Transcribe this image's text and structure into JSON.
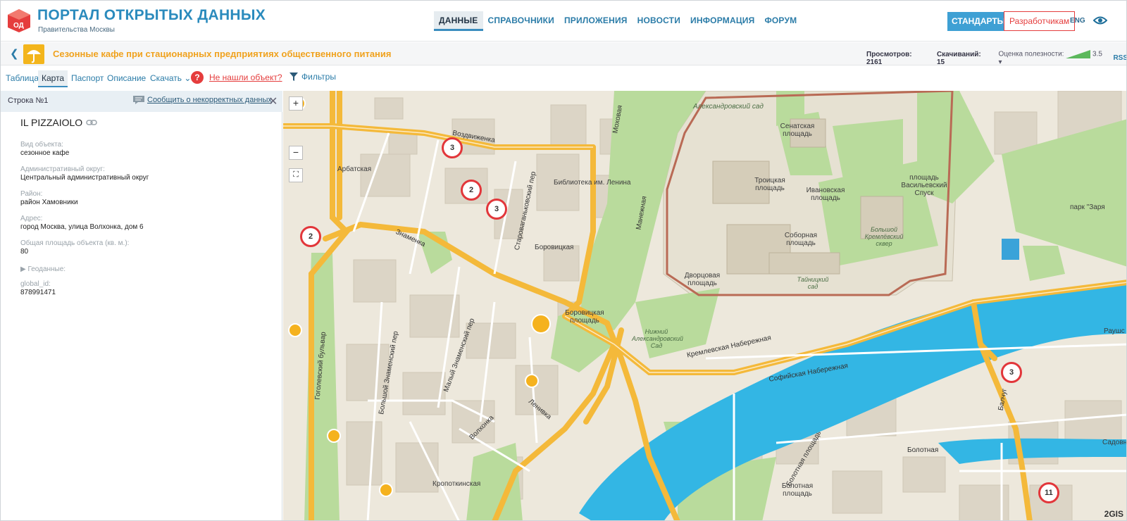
{
  "header": {
    "title": "ПОРТАЛ ОТКРЫТЫХ ДАННЫХ",
    "subtitle": "Правительства Москвы",
    "logo_text": "ОД",
    "nav": [
      "ДАННЫЕ",
      "СПРАВОЧНИКИ",
      "ПРИЛОЖЕНИЯ",
      "НОВОСТИ",
      "ИНФОРМАЦИЯ",
      "ФОРУМ"
    ],
    "standards": "СТАНДАРТЫ",
    "developers": "Разработчикам",
    "lang": "ENG"
  },
  "titlebar": {
    "title": "Сезонные кафе при стационарных предприятиях общественного питания",
    "views_label": "Просмотров:",
    "views": "2161",
    "downloads_label": "Скачиваний:",
    "downloads": "15",
    "rating_label": "Оценка полезности:",
    "rating": "3.5",
    "rss": "RSS"
  },
  "tabs": {
    "table": "Таблица",
    "map": "Карта",
    "passport": "Паспорт",
    "description": "Описание",
    "download": "Скачать",
    "not_found": "Не нашли объект?",
    "filters": "Фильтры"
  },
  "panel": {
    "row": "Строка №1",
    "report": "Сообщить о некорректных данных",
    "object_name": "IL PIZZAIOLO",
    "fields": [
      {
        "label": "Вид объекта:",
        "value": "сезонное кафе"
      },
      {
        "label": "Административный округ:",
        "value": "Центральный административный округ"
      },
      {
        "label": "Район:",
        "value": "район Хамовники"
      },
      {
        "label": "Адрес:",
        "value": "город Москва, улица Волхонка, дом 6"
      },
      {
        "label": "Общая площадь объекта (кв. м.):",
        "value": "80"
      }
    ],
    "geodata": "▶ Геоданные:",
    "global_id_label": "global_id:",
    "global_id": "878991471"
  },
  "map": {
    "labels": {
      "alex_garden_top": "Александровский сад",
      "senate_sq": "Сенатская площадь",
      "troitskaya_sq": "Троицкая площадь",
      "ivanovskaya_sq": "Ивановская площадь",
      "vasilievsky": "площадь Васильевский Спуск",
      "sobornaya": "Соборная площадь",
      "great_kremlin": "Большой Кремлёвский сквер",
      "dvortsovaya": "Дворцовая площадь",
      "tainitsky": "Тайницкий сад",
      "alex_garden_bottom": "Нижний Александровский Сад",
      "kremlin_emb": "Кремлевская Набережная",
      "sofia_emb": "Софийская Набережная",
      "arbatskaya": "Арбатская",
      "vozdvizhenka": "Воздвиженка",
      "library": "Библиотека им. Ленина",
      "borovitskaya": "Боровицкая",
      "borovitskaya_sq": "Боровицкая площадь",
      "znamenka": "Знаменка",
      "mokhovaya": "Моховая",
      "manezhnaya": "Манежная",
      "staryvagankovsky": "Староваганьковский пер",
      "maly_znamensky": "Малый Знаменский пер",
      "bolshoi_znamensky": "Большой Знаменский пер",
      "gogolevsky": "Гоголевский бульвар",
      "volkhonka": "Волхонка",
      "lenivka": "Ленивка",
      "kropotkinskaya": "Кропоткинская",
      "bolotnaya_sq": "Болотная площадь",
      "bolotnaya_sq2": "Болотная площадь",
      "bolotnaya": "Болотная",
      "balchug": "Балчуг",
      "zaryadye": "парк \"Заря",
      "raushs": "Раушс",
      "sadovn": "Садовн",
      "starovagankovsky_short": "Староваганьковский пер"
    },
    "clusters": [
      "3",
      "2",
      "3",
      "2",
      "3",
      "11"
    ],
    "attribution": "2GIS"
  },
  "colors": {
    "accent": "#2b8bbd",
    "orange": "#f0a21e",
    "red": "#e53d3d",
    "road": "#f5b92b",
    "water": "#31b6e6",
    "park": "#b7d99a"
  }
}
